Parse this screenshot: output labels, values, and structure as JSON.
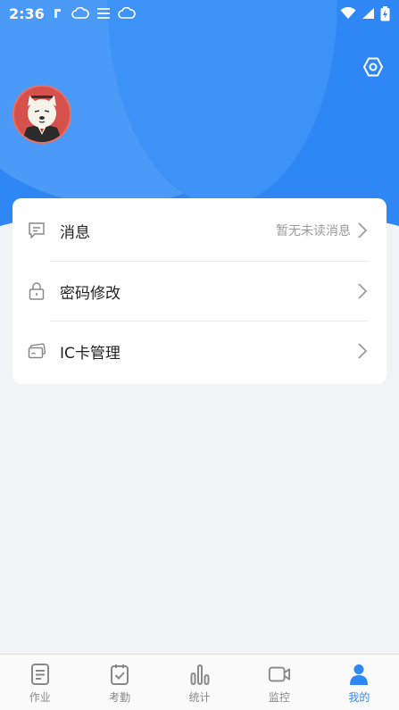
{
  "status_bar": {
    "time": "2:36"
  },
  "header": {
    "settings_icon": "settings-hex-icon"
  },
  "menu": {
    "items": [
      {
        "icon": "message-icon",
        "label": "消息",
        "meta": "暂无未读消息"
      },
      {
        "icon": "lock-icon",
        "label": "密码修改",
        "meta": ""
      },
      {
        "icon": "card-icon",
        "label": "IC卡管理",
        "meta": ""
      }
    ]
  },
  "tabbar": {
    "active": "我的",
    "tabs": [
      {
        "icon": "document-icon",
        "label": "作业"
      },
      {
        "icon": "attendance-icon",
        "label": "考勤"
      },
      {
        "icon": "chart-icon",
        "label": "统计"
      },
      {
        "icon": "video-icon",
        "label": "监控"
      },
      {
        "icon": "user-icon",
        "label": "我的"
      }
    ]
  },
  "colors": {
    "primary": "#2f87f6",
    "background": "#f2f3f6",
    "card": "#ffffff",
    "text": "#222222",
    "muted": "#9a9a9a"
  }
}
